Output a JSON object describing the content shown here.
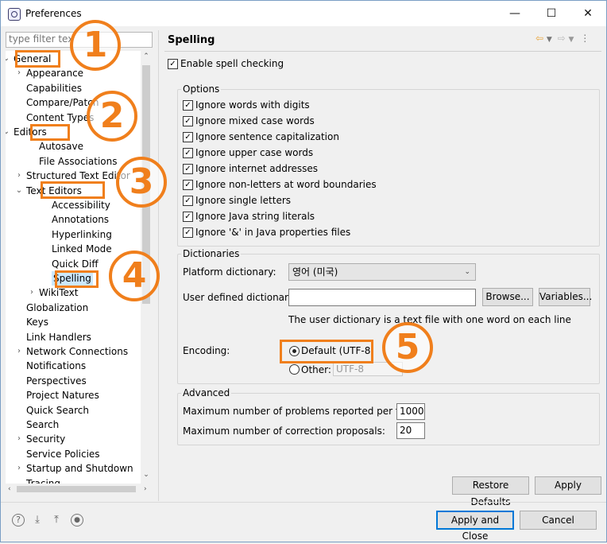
{
  "window": {
    "title": "Preferences",
    "controls": [
      "—",
      "☐",
      "✕"
    ]
  },
  "filter": {
    "placeholder": "type filter tex"
  },
  "tree": {
    "items": [
      {
        "label": "General",
        "arrow": "⌄"
      },
      {
        "label": "Appearance",
        "arrow": "›"
      },
      {
        "label": "Capabilities",
        "arrow": ""
      },
      {
        "label": "Compare/Patch",
        "arrow": ""
      },
      {
        "label": "Content Types",
        "arrow": ""
      },
      {
        "label": "Editors",
        "arrow": "⌄"
      },
      {
        "label": "Autosave",
        "arrow": ""
      },
      {
        "label": "File Associations",
        "arrow": ""
      },
      {
        "label": "Structured Text Editor",
        "arrow": "›"
      },
      {
        "label": "Text Editors",
        "arrow": "⌄"
      },
      {
        "label": "Accessibility",
        "arrow": ""
      },
      {
        "label": "Annotations",
        "arrow": ""
      },
      {
        "label": "Hyperlinking",
        "arrow": ""
      },
      {
        "label": "Linked Mode",
        "arrow": ""
      },
      {
        "label": "Quick Diff",
        "arrow": ""
      },
      {
        "label": "Spelling",
        "arrow": ""
      },
      {
        "label": "WikiText",
        "arrow": "›"
      },
      {
        "label": "Globalization",
        "arrow": ""
      },
      {
        "label": "Keys",
        "arrow": ""
      },
      {
        "label": "Link Handlers",
        "arrow": ""
      },
      {
        "label": "Network Connections",
        "arrow": "›"
      },
      {
        "label": "Notifications",
        "arrow": ""
      },
      {
        "label": "Perspectives",
        "arrow": ""
      },
      {
        "label": "Project Natures",
        "arrow": ""
      },
      {
        "label": "Quick Search",
        "arrow": ""
      },
      {
        "label": "Search",
        "arrow": ""
      },
      {
        "label": "Security",
        "arrow": "›"
      },
      {
        "label": "Service Policies",
        "arrow": ""
      },
      {
        "label": "Startup and Shutdown",
        "arrow": "›"
      },
      {
        "label": "Tracing",
        "arrow": ""
      }
    ]
  },
  "page": {
    "title": "Spelling",
    "enable_label": "Enable spell checking",
    "enable_checked": true
  },
  "options": {
    "title": "Options",
    "items": [
      {
        "label": "Ignore words with digits",
        "checked": true
      },
      {
        "label": "Ignore mixed case words",
        "checked": true
      },
      {
        "label": "Ignore sentence capitalization",
        "checked": true
      },
      {
        "label": "Ignore upper case words",
        "checked": true
      },
      {
        "label": "Ignore internet addresses",
        "checked": true
      },
      {
        "label": "Ignore non-letters at word boundaries",
        "checked": true
      },
      {
        "label": "Ignore single letters",
        "checked": true
      },
      {
        "label": "Ignore Java string literals",
        "checked": true
      },
      {
        "label": "Ignore '&' in Java properties files",
        "checked": true
      }
    ]
  },
  "dictionaries": {
    "title": "Dictionaries",
    "platform_label": "Platform dictionary:",
    "platform_value": "영어 (미국)",
    "user_label": "User defined dictionary:",
    "user_value": "",
    "browse_label": "Browse...",
    "variables_label": "Variables...",
    "hint": "The user dictionary is a text file with one word on each line",
    "encoding_label": "Encoding:",
    "default_label": "Default (UTF-8)",
    "other_label": "Other:",
    "other_value": "UTF-8"
  },
  "advanced": {
    "title": "Advanced",
    "problems_label": "Maximum number of problems reported per file:",
    "problems_value": "1000",
    "proposals_label": "Maximum number of correction proposals:",
    "proposals_value": "20"
  },
  "buttons": {
    "restore": "Restore Defaults",
    "apply": "Apply",
    "apply_close": "Apply and Close",
    "cancel": "Cancel"
  },
  "annotations": [
    "1",
    "2",
    "3",
    "4",
    "5"
  ],
  "accent_color": "#f07f1c",
  "footer_icons": [
    "help-icon",
    "import-icon",
    "export-icon",
    "record-icon"
  ]
}
